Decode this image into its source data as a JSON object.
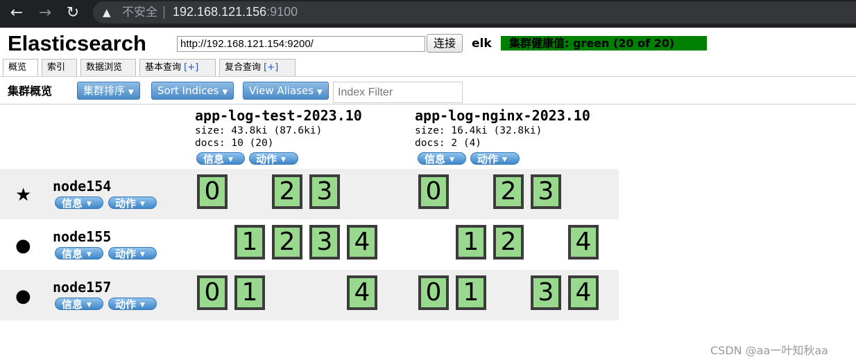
{
  "browser": {
    "back_icon": "back-arrow-icon",
    "forward_icon": "forward-arrow-icon",
    "reload_icon": "reload-icon",
    "warning_icon": "warning-triangle-icon",
    "insecure_label": "不安全",
    "url_host": "192.168.121.156",
    "url_port": ":9100"
  },
  "header": {
    "logo": "Elasticsearch",
    "connect_url": "http://192.168.121.154:9200/",
    "connect_button": "连接",
    "cluster_name": "elk",
    "health": "集群健康值: green (20 of 20)",
    "health_color": "#008000"
  },
  "tabs": [
    {
      "label": "概览"
    },
    {
      "label": "索引"
    },
    {
      "label": "数据浏览"
    },
    {
      "label": "基本查询",
      "plus": "[+]"
    },
    {
      "label": "复合查询",
      "plus": "[+]"
    }
  ],
  "toolbar": {
    "title": "集群概览",
    "sort_cluster": "集群排序",
    "sort_indices": "Sort Indices",
    "view_aliases": "View Aliases",
    "filter_placeholder": "Index Filter"
  },
  "buttons": {
    "info": "信息",
    "action": "动作"
  },
  "indices": [
    {
      "name": "app-log-test-2023.10",
      "size": "size: 43.8ki (87.6ki)",
      "docs": "docs: 10 (20)"
    },
    {
      "name": "app-log-nginx-2023.10",
      "size": "size: 16.4ki (32.8ki)",
      "docs": "docs: 2 (4)"
    }
  ],
  "nodes": [
    {
      "name": "node154",
      "icon": "star-icon",
      "icon_glyph": "★",
      "shards": [
        [
          "0",
          "",
          "2",
          "3",
          ""
        ],
        [
          "0",
          "",
          "2",
          "3",
          ""
        ]
      ]
    },
    {
      "name": "node155",
      "icon": "circle-icon",
      "icon_glyph": "●",
      "shards": [
        [
          "",
          "1",
          "2",
          "3",
          "4"
        ],
        [
          "",
          "1",
          "2",
          "",
          "4"
        ]
      ]
    },
    {
      "name": "node157",
      "icon": "circle-icon",
      "icon_glyph": "●",
      "shards": [
        [
          "0",
          "1",
          "",
          "",
          "4"
        ],
        [
          "0",
          "1",
          "",
          "3",
          "4"
        ]
      ]
    }
  ],
  "shard_colors": {
    "fill": "#98d98e",
    "border": "#3c3c3c"
  },
  "watermark": "CSDN @aa一叶知秋aa"
}
